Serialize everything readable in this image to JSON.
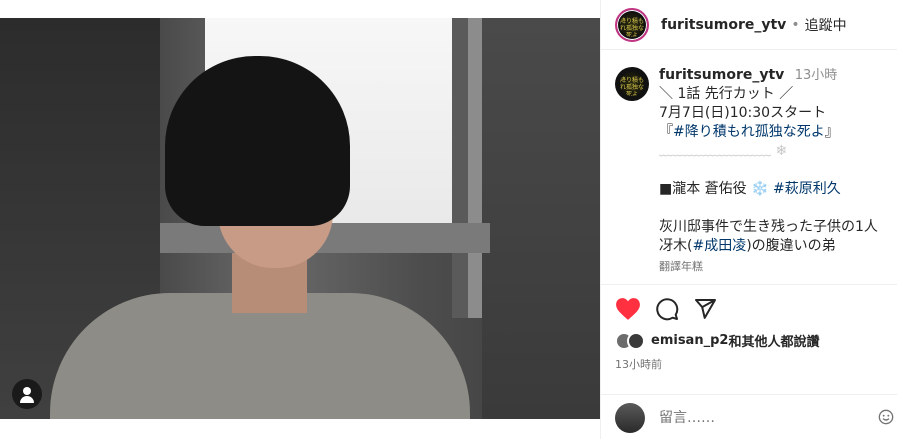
{
  "header": {
    "username": "furitsumore_ytv",
    "separator": "•",
    "follow_label": "追蹤中",
    "logo_text": "降り積もれ孤独な死よ"
  },
  "caption": {
    "username": "furitsumore_ytv",
    "time": "13小時",
    "lines": {
      "l1": "＼ 1話 先行カット ／",
      "l2": "7月7日(日)10:30スタート",
      "l3_pre": "『",
      "l3_tag": "#降り積もれ孤独な死よ",
      "l3_post": "』",
      "l4": "﹏﹏﹏﹏﹏﹏﹏﹏ ❄",
      "l5_pre": "■瀧本 蒼佑役 ❄️ ",
      "l5_tag": "#萩原利久",
      "l6": "灰川邸事件で生き残った子供の1人",
      "l7_pre": "冴木(",
      "l7_tag": "#成田凌",
      "l7_post": ")の腹違いの弟"
    },
    "translate_label": "翻譯年糕"
  },
  "actions": {
    "like_icon": "heart-icon",
    "comment_icon": "comment-icon",
    "share_icon": "send-icon",
    "likes_user": "emisan_p2",
    "likes_tail": "和其他人都說讚",
    "time_ago": "13小時前"
  },
  "comment_box": {
    "placeholder": "留言……"
  },
  "colors": {
    "like": "#ff3040",
    "link": "#00376b",
    "story_ring": "#c13584"
  }
}
